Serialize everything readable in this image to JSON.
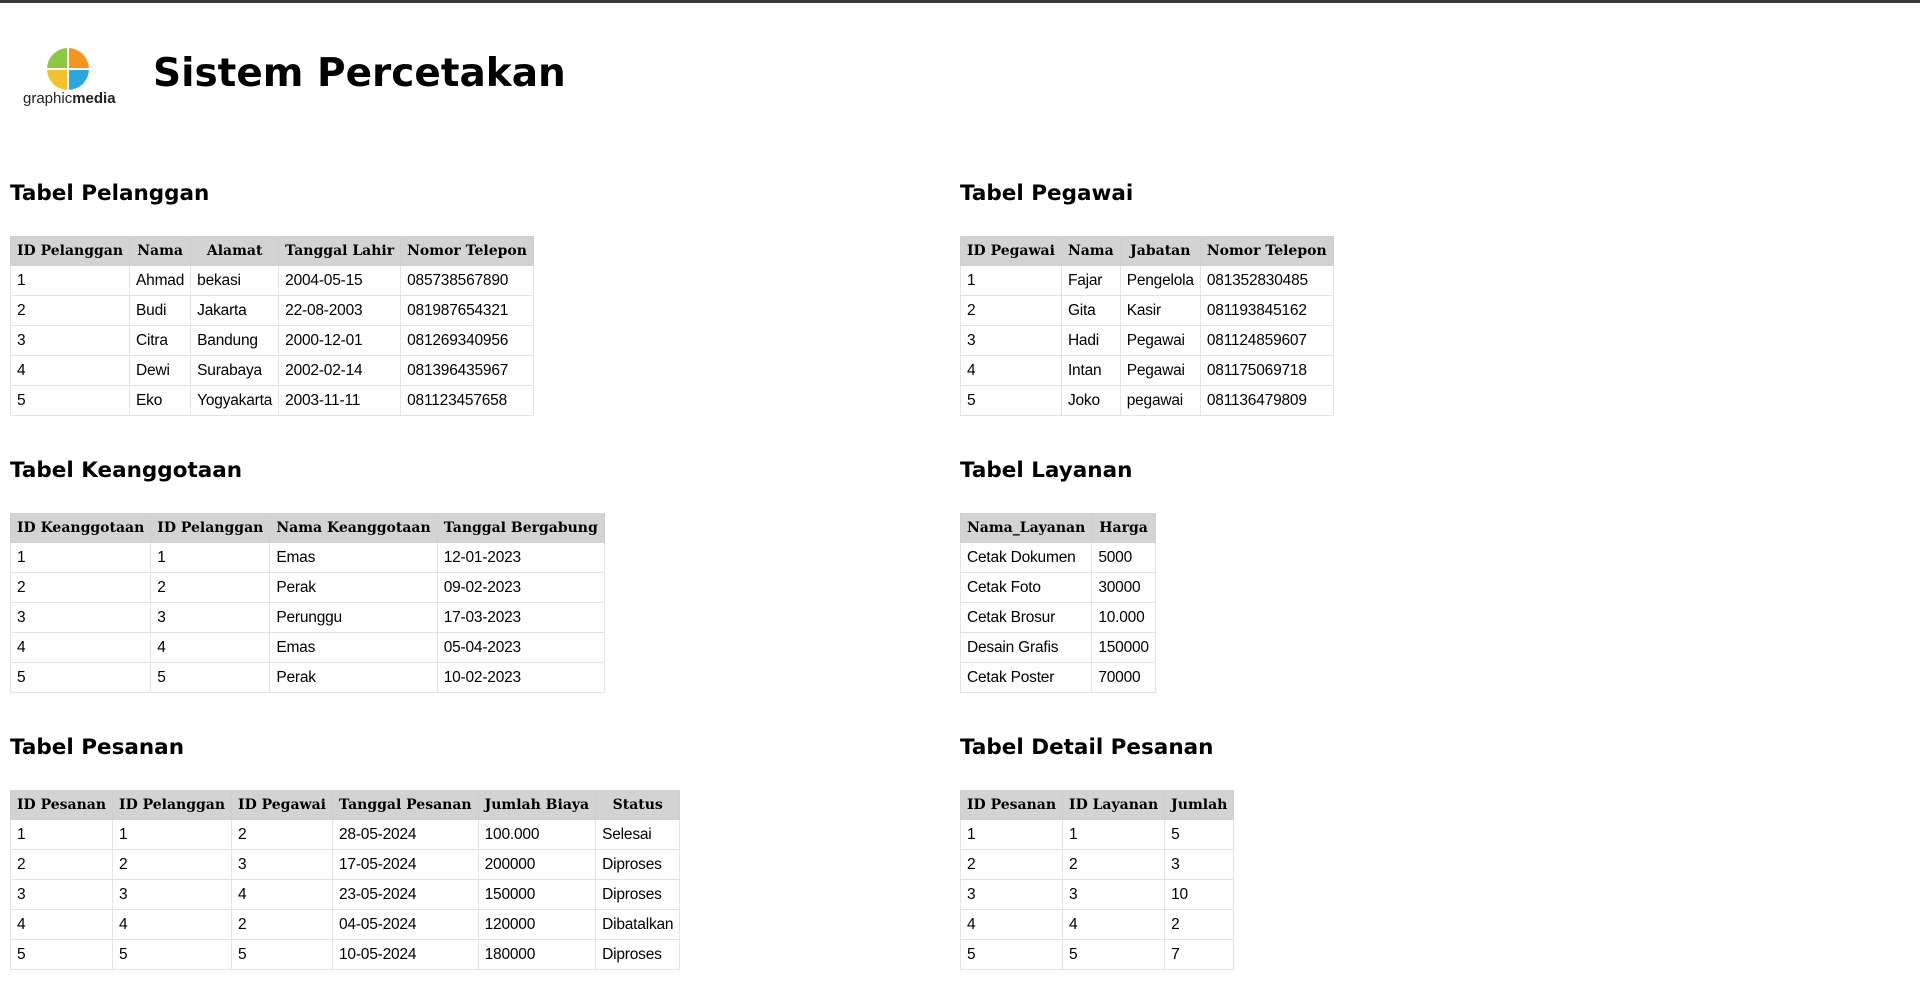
{
  "header": {
    "logo_text_light": "graphic",
    "logo_text_bold": "media",
    "title": "Sistem Percetakan"
  },
  "tables": {
    "pelanggan": {
      "title": "Tabel Pelanggan",
      "headers": [
        "ID Pelanggan",
        "Nama",
        "Alamat",
        "Tanggal Lahir",
        "Nomor Telepon"
      ],
      "rows": [
        [
          "1",
          "Ahmad",
          "bekasi",
          "2004-05-15",
          "085738567890"
        ],
        [
          "2",
          "Budi",
          "Jakarta",
          "22-08-2003",
          "081987654321"
        ],
        [
          "3",
          "Citra",
          "Bandung",
          "2000-12-01",
          "081269340956"
        ],
        [
          "4",
          "Dewi",
          "Surabaya",
          "2002-02-14",
          "081396435967"
        ],
        [
          "5",
          "Eko",
          "Yogyakarta",
          "2003-11-11",
          "081123457658"
        ]
      ]
    },
    "pegawai": {
      "title": "Tabel Pegawai",
      "headers": [
        "ID Pegawai",
        "Nama",
        "Jabatan",
        "Nomor Telepon"
      ],
      "rows": [
        [
          "1",
          "Fajar",
          "Pengelola",
          "081352830485"
        ],
        [
          "2",
          "Gita",
          "Kasir",
          "081193845162"
        ],
        [
          "3",
          "Hadi",
          "Pegawai",
          "081124859607"
        ],
        [
          "4",
          "Intan",
          "Pegawai",
          "081175069718"
        ],
        [
          "5",
          "Joko",
          "pegawai",
          "081136479809"
        ]
      ]
    },
    "keanggotaan": {
      "title": "Tabel Keanggotaan",
      "headers": [
        "ID Keanggotaan",
        "ID Pelanggan",
        "Nama Keanggotaan",
        "Tanggal Bergabung"
      ],
      "rows": [
        [
          "1",
          "1",
          "Emas",
          "12-01-2023"
        ],
        [
          "2",
          "2",
          "Perak",
          "09-02-2023"
        ],
        [
          "3",
          "3",
          "Perunggu",
          "17-03-2023"
        ],
        [
          "4",
          "4",
          "Emas",
          "05-04-2023"
        ],
        [
          "5",
          "5",
          "Perak",
          "10-02-2023"
        ]
      ]
    },
    "layanan": {
      "title": "Tabel Layanan",
      "headers": [
        "Nama_Layanan",
        "Harga"
      ],
      "rows": [
        [
          "Cetak Dokumen",
          "5000"
        ],
        [
          "Cetak Foto",
          "30000"
        ],
        [
          "Cetak Brosur",
          "10.000"
        ],
        [
          "Desain Grafis",
          "150000"
        ],
        [
          "Cetak Poster",
          "70000"
        ]
      ]
    },
    "pesanan": {
      "title": "Tabel Pesanan",
      "headers": [
        "ID Pesanan",
        "ID Pelanggan",
        "ID Pegawai",
        "Tanggal Pesanan",
        "Jumlah Biaya",
        "Status"
      ],
      "rows": [
        [
          "1",
          "1",
          "2",
          "28-05-2024",
          "100.000",
          "Selesai"
        ],
        [
          "2",
          "2",
          "3",
          "17-05-2024",
          "200000",
          "Diproses"
        ],
        [
          "3",
          "3",
          "4",
          "23-05-2024",
          "150000",
          "Diproses"
        ],
        [
          "4",
          "4",
          "2",
          "04-05-2024",
          "120000",
          "Dibatalkan"
        ],
        [
          "5",
          "5",
          "5",
          "10-05-2024",
          "180000",
          "Diproses"
        ]
      ]
    },
    "detail_pesanan": {
      "title": "Tabel Detail Pesanan",
      "headers": [
        "ID Pesanan",
        "ID Layanan",
        "Jumlah"
      ],
      "rows": [
        [
          "1",
          "1",
          "5"
        ],
        [
          "2",
          "2",
          "3"
        ],
        [
          "3",
          "3",
          "10"
        ],
        [
          "4",
          "4",
          "2"
        ],
        [
          "5",
          "5",
          "7"
        ]
      ]
    }
  }
}
